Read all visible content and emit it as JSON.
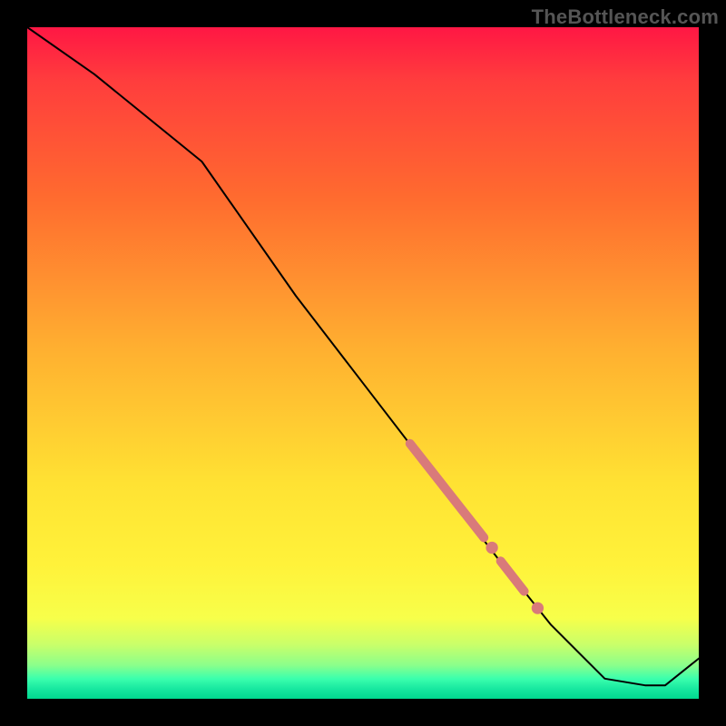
{
  "watermark": "TheBottleneck.com",
  "chart_data": {
    "type": "line",
    "title": "",
    "xlabel": "",
    "ylabel": "",
    "xlim": [
      0,
      100
    ],
    "ylim": [
      0,
      100
    ],
    "grid": false,
    "legend": false,
    "series": [
      {
        "name": "curve",
        "color": "#000000",
        "x": [
          0,
          10,
          26,
          40,
          50,
          60,
          70,
          78,
          86,
          92,
          95,
          100
        ],
        "y": [
          100,
          93,
          80,
          60,
          47,
          34,
          21,
          11,
          3,
          2,
          2,
          6
        ]
      }
    ],
    "markers": [
      {
        "name": "highlight-segment",
        "shape": "thick-line",
        "color": "#d97a7a",
        "x": [
          57,
          68
        ],
        "y": [
          38,
          24
        ]
      },
      {
        "name": "highlight-dash-1",
        "shape": "thick-line",
        "color": "#d97a7a",
        "x": [
          70.5,
          74
        ],
        "y": [
          20.5,
          16
        ]
      },
      {
        "name": "highlight-dot-1",
        "shape": "dot",
        "color": "#d97a7a",
        "x": 69.2,
        "y": 22.5
      },
      {
        "name": "highlight-dot-2",
        "shape": "dot",
        "color": "#d97a7a",
        "x": 76,
        "y": 13.5
      }
    ],
    "background_gradient": {
      "direction": "vertical",
      "stops": [
        {
          "pos": 0.0,
          "color": "#ff1744"
        },
        {
          "pos": 0.25,
          "color": "#ff6a2f"
        },
        {
          "pos": 0.5,
          "color": "#ffb030"
        },
        {
          "pos": 0.8,
          "color": "#fff23a"
        },
        {
          "pos": 0.95,
          "color": "#8bff8b"
        },
        {
          "pos": 1.0,
          "color": "#00d88f"
        }
      ]
    }
  }
}
